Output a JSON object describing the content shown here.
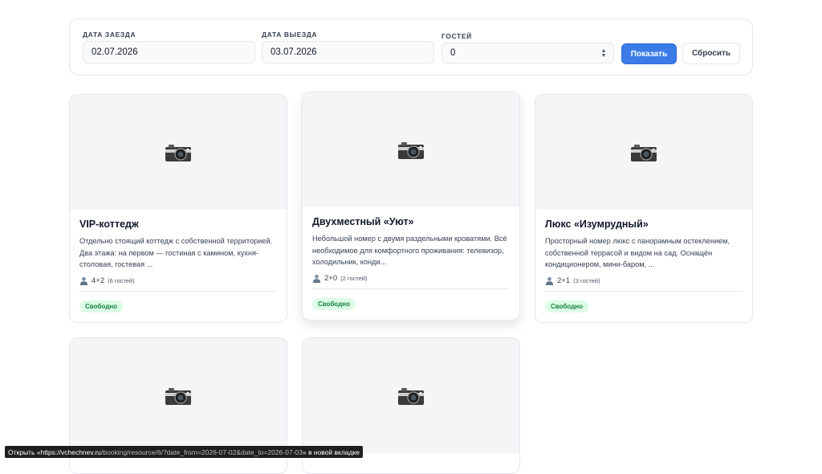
{
  "filters": {
    "checkin_label": "ДАТА ЗАЕЗДА",
    "checkin_value": "02.07.2026",
    "checkout_label": "ДАТА ВЫЕЗДА",
    "checkout_value": "03.07.2026",
    "guests_label": "ГОСТЕЙ",
    "guests_value": "0",
    "show_button": "Показать",
    "reset_button": "Сбросить"
  },
  "cards": [
    {
      "title": "VIP-коттедж",
      "description": "Отдельно стоящий коттедж с собственной территорией. Два этажа: на первом — гостиная с камином, кухня-столовая, гостевая ...",
      "guests": "4+2",
      "guests_total": "(6 гостей)",
      "status": "Свободно"
    },
    {
      "title": "Двухместный «Уют»",
      "description": "Небольшой номер с двумя раздельными кроватями. Всё необходимое для комфортного проживания: телевизор, холодильник, конди...",
      "guests": "2+0",
      "guests_total": "(2 гостей)",
      "status": "Свободно"
    },
    {
      "title": "Люкс «Изумрудный»",
      "description": "Просторный номер люкс с панорамным остеклением, собственной террасой и видом на сад. Оснащён кондиционером, мини-баром, ...",
      "guests": "2+1",
      "guests_total": "(3 гостей)",
      "status": "Свободно"
    },
    {
      "title": "",
      "description": ""
    },
    {
      "title": "",
      "description": ""
    }
  ],
  "status_bar": {
    "prefix": "Открыть «https://vchechnev.ru",
    "path": "/booking/resource/6/?date_from=2026-07-02&date_to=2026-07-03",
    "suffix": "» в новой вкладке"
  },
  "icons": {
    "card_image": "camera-icon",
    "guests": "user-icon",
    "stepper": "chevron-up-down-icon"
  },
  "colors": {
    "primary": "#3b7be8",
    "badge_bg": "#dcfce7",
    "badge_text": "#15803d"
  }
}
